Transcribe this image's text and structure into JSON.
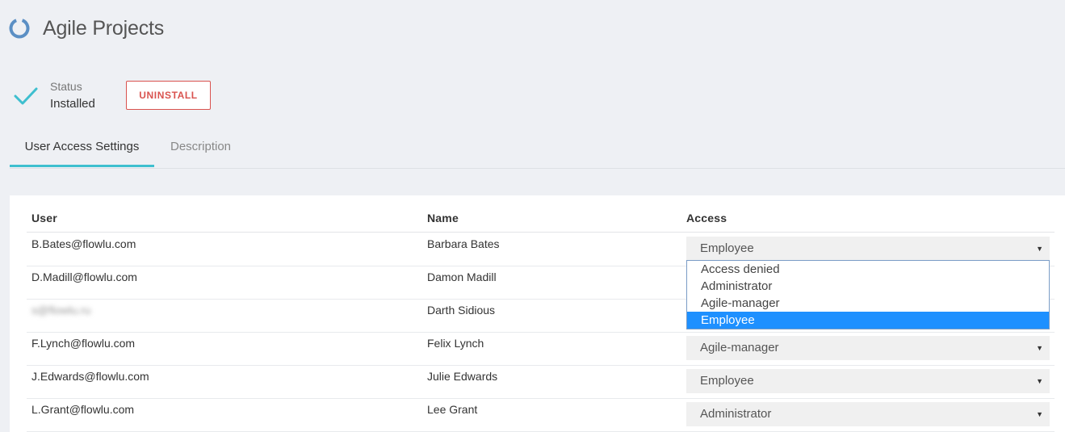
{
  "header": {
    "title": "Agile Projects"
  },
  "status": {
    "label": "Status",
    "value": "Installed"
  },
  "buttons": {
    "uninstall": "UNINSTALL"
  },
  "tabs": [
    {
      "label": "User Access Settings",
      "active": true
    },
    {
      "label": "Description",
      "active": false
    }
  ],
  "table": {
    "columns": [
      "User",
      "Name",
      "Access"
    ],
    "rows": [
      {
        "user": "B.Bates@flowlu.com",
        "name": "Barbara Bates",
        "access": "Employee"
      },
      {
        "user": "D.Madill@flowlu.com",
        "name": "Damon Madill",
        "access": ""
      },
      {
        "user": "s@flowlu.ru",
        "name": "Darth Sidious",
        "access": ""
      },
      {
        "user": "F.Lynch@flowlu.com",
        "name": "Felix Lynch",
        "access": "Agile-manager"
      },
      {
        "user": "J.Edwards@flowlu.com",
        "name": "Julie Edwards",
        "access": "Employee"
      },
      {
        "user": "L.Grant@flowlu.com",
        "name": "Lee Grant",
        "access": "Administrator"
      }
    ]
  },
  "dropdown": {
    "options": [
      "Access denied",
      "Administrator",
      "Agile-manager",
      "Employee"
    ],
    "selected": "Employee"
  },
  "colors": {
    "accent": "#3ebfcf",
    "danger": "#d9534f",
    "highlight": "#1e90ff"
  },
  "icons": {
    "app": "circle-loader-icon",
    "status": "checkmark-icon",
    "select_arrow": "caret-down-icon"
  }
}
